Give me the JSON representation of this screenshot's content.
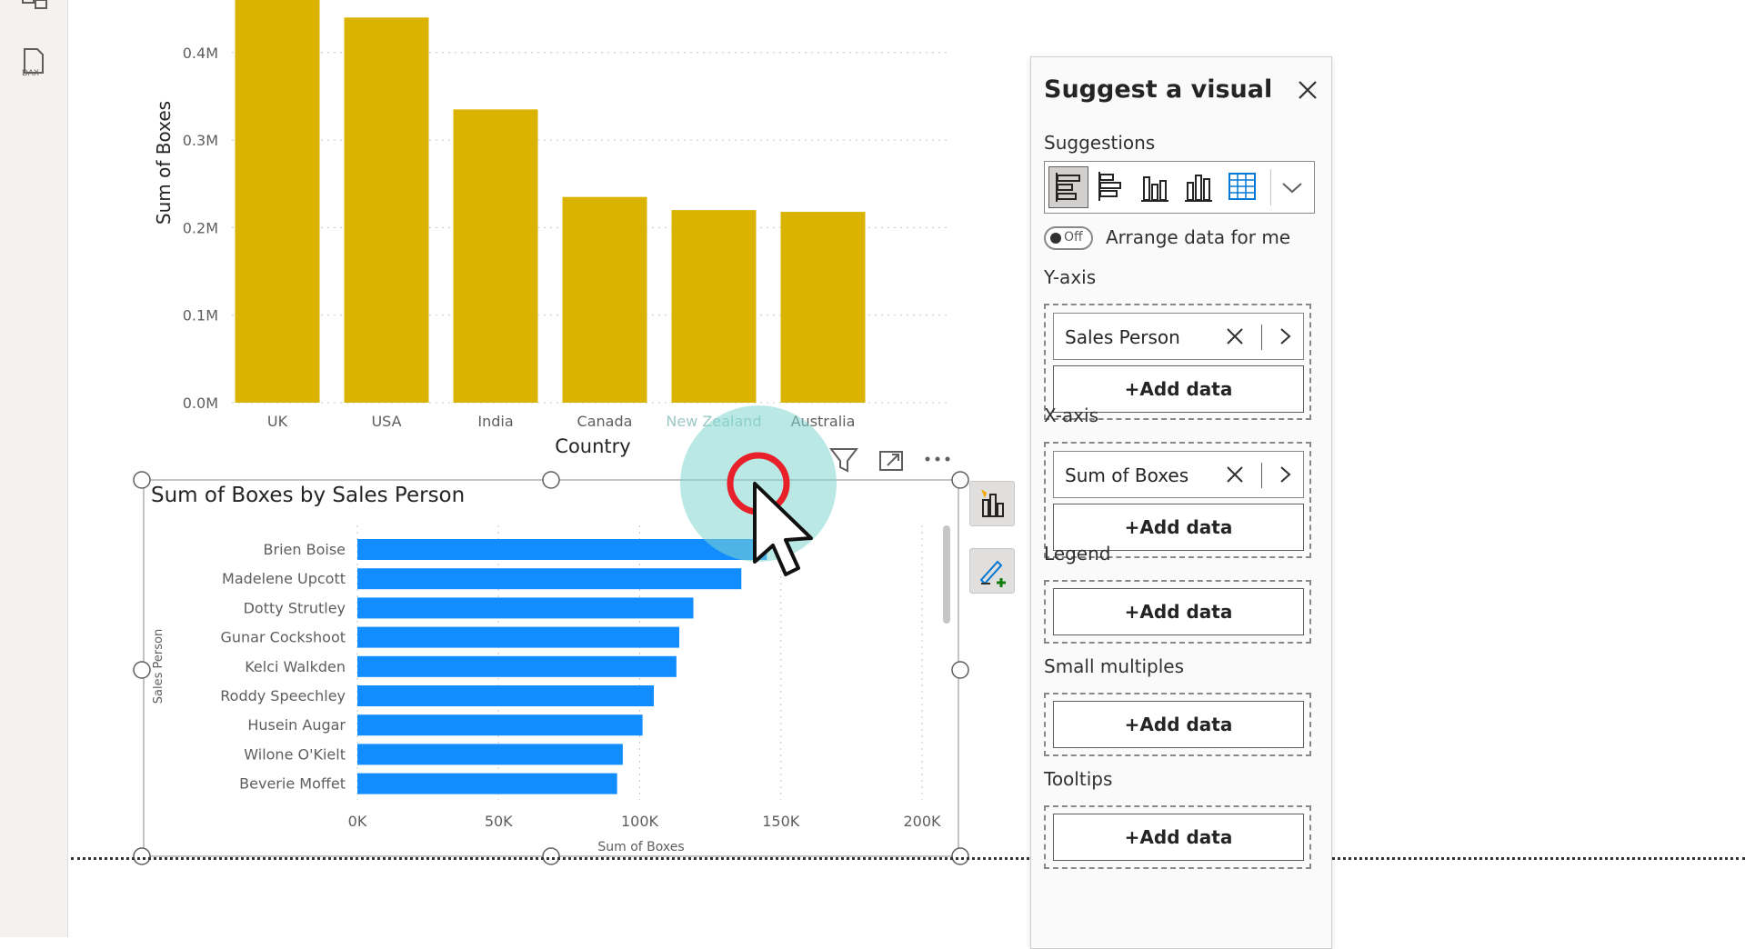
{
  "chart_data": [
    {
      "type": "bar",
      "categories": [
        "UK",
        "USA",
        "India",
        "Canada",
        "New Zealand",
        "Australia"
      ],
      "values": [
        0.46,
        0.44,
        0.335,
        0.235,
        0.22,
        0.218
      ],
      "ylabel": "Sum of Boxes",
      "xlabel": "Country",
      "y_ticks": [
        "0.0M",
        "0.1M",
        "0.2M",
        "0.3M",
        "0.4M"
      ],
      "y_tick_values": [
        0,
        0.1,
        0.2,
        0.3,
        0.4
      ],
      "ylim": [
        0,
        0.46
      ],
      "value_unit": "M",
      "color": "#d9b300",
      "grid": true
    },
    {
      "type": "bar",
      "orientation": "horizontal",
      "title": "Sum of Boxes by Sales Person",
      "categories": [
        "Brien Boise",
        "Madelene Upcott",
        "Dotty Strutley",
        "Gunar Cockshoot",
        "Kelci Walkden",
        "Roddy Speechley",
        "Husein Augar",
        "Wilone O'Kielt",
        "Beverie Moffet"
      ],
      "values": [
        145000,
        136000,
        119000,
        114000,
        113000,
        105000,
        101000,
        94000,
        92000
      ],
      "xlabel": "Sum of Boxes",
      "ylabel": "Sales Person",
      "x_ticks": [
        "0K",
        "50K",
        "100K",
        "150K",
        "200K"
      ],
      "x_tick_values": [
        0,
        50000,
        100000,
        150000,
        200000
      ],
      "xlim": [
        0,
        200000
      ],
      "color": "#118dff",
      "grid": true
    }
  ],
  "visual_header": {
    "filter_icon": "filter-icon",
    "focus_icon": "focus-mode-icon",
    "more_icon": "more-options-icon"
  },
  "side_buttons": [
    "build-visual-icon",
    "format-visual-icon"
  ],
  "panel": {
    "title": "Suggest a visual",
    "suggestions_label": "Suggestions",
    "suggestion_icons": [
      "clustered-bar-chart-icon",
      "stacked-bar-chart-icon",
      "clustered-column-chart-icon",
      "stacked-column-chart-icon",
      "table-icon"
    ],
    "toggle_state": "Off",
    "toggle_label": "Arrange data for me",
    "y_axis": {
      "label": "Y-axis",
      "field": "Sales Person"
    },
    "x_axis": {
      "label": "X-axis",
      "field": "Sum of Boxes"
    },
    "legend_label": "Legend",
    "small_multiples_label": "Small multiples",
    "tooltips_label": "Tooltips",
    "add_data": "+Add data"
  },
  "colors": {
    "accent_yellow": "#d9b300",
    "accent_blue": "#118dff",
    "cursor_highlight": "#7fd6cf",
    "click_ring": "#e8202a"
  }
}
